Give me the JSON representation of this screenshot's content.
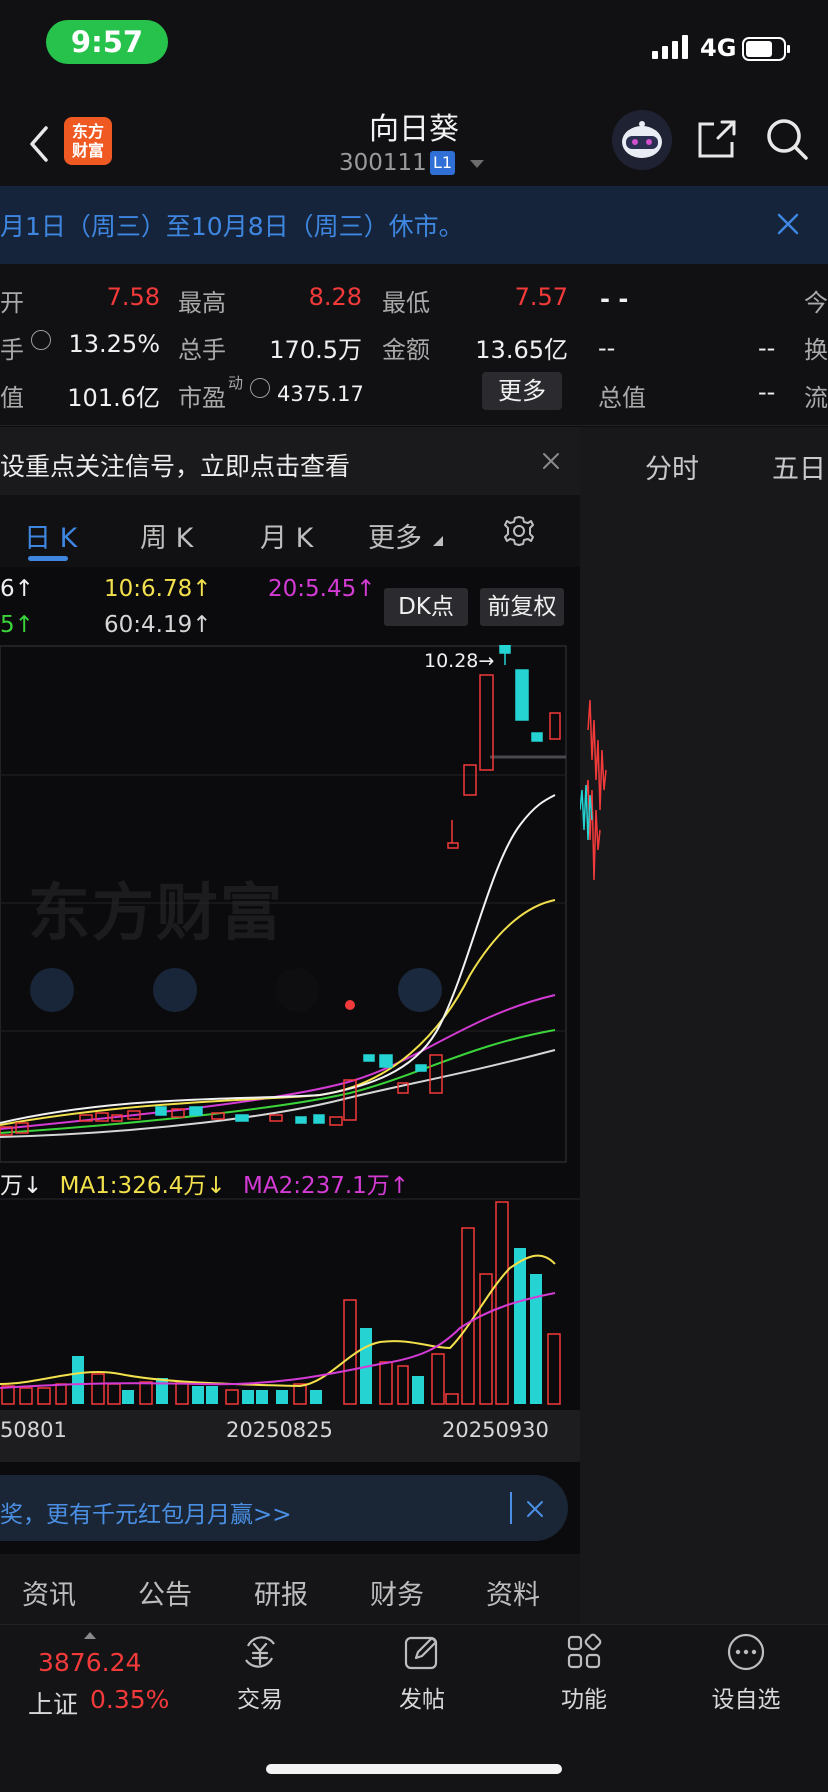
{
  "status": {
    "time": "9:57",
    "network": "4G"
  },
  "header": {
    "logo_line1": "东方",
    "logo_line2": "财富",
    "title": "向日葵",
    "code": "300111",
    "level": "L1"
  },
  "notice": {
    "text": "月1日（周三）至10月8日（周三）休市。"
  },
  "quote": {
    "open_label": "开",
    "open_value": "7.58",
    "high_label": "最高",
    "high_value": "8.28",
    "low_label": "最低",
    "low_value": "7.57",
    "turnover_label": "手",
    "turnover_value": "13.25%",
    "volume_label": "总手",
    "volume_value": "170.5万",
    "amount_label": "金额",
    "amount_value": "13.65亿",
    "mcap_label": "值",
    "mcap_value": "101.6亿",
    "pe_label": "市盈",
    "pe_sup": "动",
    "pe_value": "4375.17",
    "more": "更多",
    "right_dash": "- -",
    "right_today": "今",
    "right_hsl": "换",
    "right_dash2": "--",
    "right_dash3": "--",
    "right_total": "总值",
    "right_dash4": "--",
    "right_flow": "流"
  },
  "signal": {
    "text": "设重点关注信号，立即点击查看"
  },
  "right_tabs": {
    "fenshi": "分时",
    "wuri": "五日"
  },
  "ktabs": {
    "day": "日 K",
    "week": "周 K",
    "month": "月 K",
    "more": "更多"
  },
  "ma_legend": {
    "ma5": "6↑",
    "ma10": "10:6.78↑",
    "ma20": "20:5.45↑",
    "ma30": "5↑",
    "ma60": "60:4.19↑"
  },
  "buttons": {
    "dk": "DK点",
    "fq": "前复权"
  },
  "chart": {
    "high_marker": "10.28→",
    "watermark": "东方财富"
  },
  "vol_legend": {
    "vol": "万↓",
    "ma1": "MA1:326.4万↓",
    "ma2": "MA2:237.1万↑"
  },
  "dates": {
    "d1": "50801",
    "d2": "20250825",
    "d3": "20250930"
  },
  "promo": {
    "text": "奖，更有千元红包月月赢>>"
  },
  "info_tabs": {
    "news": "资讯",
    "notice": "公告",
    "research": "研报",
    "finance": "财务",
    "profile": "资料"
  },
  "bottom_nav": {
    "index_value": "3876.24",
    "index_name": "上证",
    "index_change": "0.35%",
    "trade": "交易",
    "post": "发帖",
    "func": "功能",
    "watch": "设自选"
  },
  "colors": {
    "up": "#f23a3a",
    "down": "#25d3d3",
    "accent": "#3f86e0"
  },
  "chart_data": {
    "type": "candlestick",
    "price_annotation": "10.28",
    "volume_moving_average_values": {
      "MA1": "326.4万",
      "MA2": "237.1万"
    },
    "moving_average_values": {
      "MA10": 6.78,
      "MA20": 5.45,
      "MA60": 4.19
    },
    "x_tick_labels": [
      "50801",
      "20250825",
      "20250930"
    ]
  }
}
